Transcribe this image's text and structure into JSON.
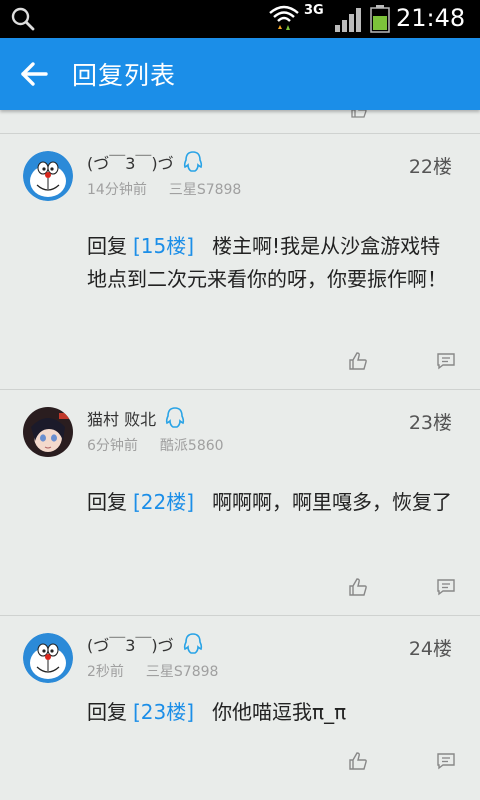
{
  "status_bar": {
    "network": "3G",
    "time": "21:48",
    "icons": [
      "search-icon",
      "wifi-icon",
      "signal-icon",
      "battery-icon"
    ]
  },
  "app_bar": {
    "title": "回复列表",
    "back_icon": "arrow-left-icon"
  },
  "colors": {
    "accent": "#1b8ee8",
    "background": "#e9ecea",
    "battery": "#7cc23a"
  },
  "replies": [
    {
      "name": "(づ￣3￣)づ",
      "time": "14分钟前",
      "device": "三星S7898",
      "floor": "22楼",
      "reply_word": "回复",
      "reply_to": "[15楼]",
      "text": "楼主啊!我是从沙盒游戏特地点到二次元来看你的呀，你要振作啊！",
      "avatar": "doraemon-avatar"
    },
    {
      "name": "猫村 败北",
      "time": "6分钟前",
      "device": "酷派5860",
      "floor": "23楼",
      "reply_word": "回复",
      "reply_to": "[22楼]",
      "text": "啊啊啊，啊里嘎多，恢复了",
      "avatar": "anime-girl-avatar"
    },
    {
      "name": "(づ￣3￣)づ",
      "time": "2秒前",
      "device": "三星S7898",
      "floor": "24楼",
      "reply_word": "回复",
      "reply_to": "[23楼]",
      "text": "你他喵逗我π_π",
      "avatar": "doraemon-avatar"
    }
  ]
}
